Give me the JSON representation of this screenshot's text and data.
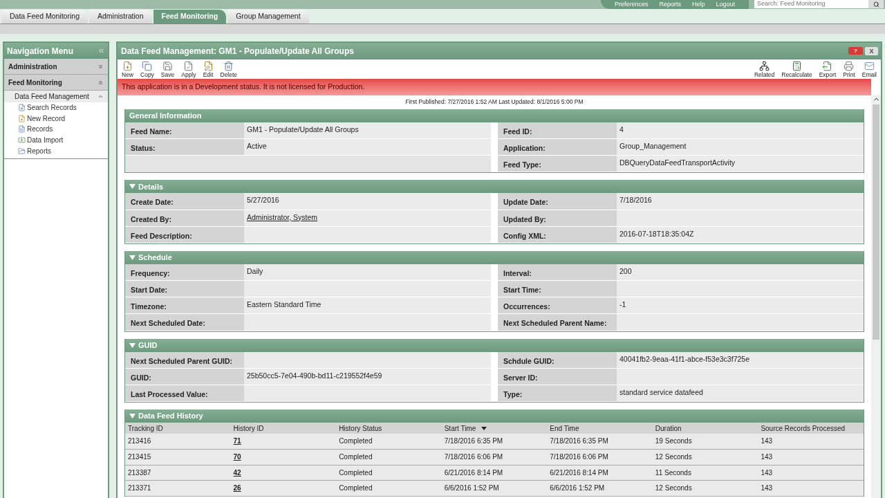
{
  "header": {
    "links": [
      "Preferences",
      "Reports",
      "Help",
      "Logout"
    ],
    "search": {
      "placeholder": "Search: Feed Monitoring"
    }
  },
  "tabs": [
    {
      "label": "Data Feed Monitoring",
      "selected": false
    },
    {
      "label": "Administration",
      "selected": false
    },
    {
      "label": "Feed Monitoring",
      "selected": true
    },
    {
      "label": "Group Management",
      "selected": false
    }
  ],
  "sidebar": {
    "title": "Navigation Menu",
    "groups": [
      {
        "label": "Administration",
        "expanded": false
      },
      {
        "label": "Feed Monitoring",
        "expanded": true,
        "children": [
          {
            "label": "Data Feed Management",
            "expanded": true,
            "children": [
              {
                "label": "Search Records"
              },
              {
                "label": "New Record"
              },
              {
                "label": "Records"
              },
              {
                "label": "Data Import"
              },
              {
                "label": "Reports"
              }
            ]
          }
        ]
      }
    ]
  },
  "window": {
    "title": "Data Feed Management: GM1 - Populate/Update All Groups",
    "help_button": "?",
    "close_button": "X"
  },
  "toolbar": {
    "left": [
      "New",
      "Copy",
      "Save",
      "Apply",
      "Edit",
      "Delete"
    ],
    "right": [
      "Related",
      "Recalculate",
      "Export",
      "Print",
      "Email"
    ]
  },
  "alert": "This application is in a Development status. It is not licensed for Production.",
  "published": "First Published: 7/27/2016 1:52 AM Last Updated: 8/1/2016 5:00 PM",
  "sections": [
    {
      "title": "General Information",
      "rows": [
        {
          "left": {
            "label": "Feed Name:",
            "value": "GM1 - Populate/Update All Groups",
            "kind": "text"
          },
          "right": {
            "label": "Feed ID:",
            "value": "4",
            "kind": "text"
          }
        },
        {
          "left": {
            "label": "Status:",
            "value": "Active",
            "kind": "text"
          },
          "right": {
            "label": "Application:",
            "value": "Group_Management",
            "kind": "text"
          }
        },
        {
          "right": {
            "label": "Feed Type:",
            "value": "DBQueryDataFeedTransportActivity",
            "kind": "text"
          }
        }
      ]
    },
    {
      "title": "Details",
      "expanded": true,
      "rows": [
        {
          "left": {
            "label": "Create Date:",
            "value": "5/27/2016",
            "kind": "text"
          },
          "right": {
            "label": "Update Date:",
            "value": "7/18/2016",
            "kind": "text"
          }
        },
        {
          "left": {
            "label": "Created By:",
            "value": "Administrator, System",
            "kind": "link"
          },
          "right": {
            "label": "Updated By:"
          }
        },
        {
          "left": {
            "label": "Feed Description:"
          },
          "right": {
            "label": "Config XML:",
            "value": "2016-07-18T18:35:04Z",
            "kind": "text"
          }
        }
      ]
    },
    {
      "title": "Schedule",
      "expanded": true,
      "rows": [
        {
          "left": {
            "label": "Frequency:",
            "value": "Daily",
            "kind": "text"
          },
          "right": {
            "label": "Interval:",
            "value": "200",
            "kind": "text"
          }
        },
        {
          "left": {
            "label": "Start Date:"
          },
          "right": {
            "label": "Start Time:"
          }
        },
        {
          "left": {
            "label": "Timezone:",
            "value": "Eastern Standard Time",
            "kind": "text"
          },
          "right": {
            "label": "Occurrences:",
            "value": "-1",
            "kind": "text"
          }
        },
        {
          "left": {
            "label": "Next Scheduled Date:"
          },
          "right": {
            "label": "Next Scheduled Parent Name:"
          }
        }
      ]
    },
    {
      "title": "GUID",
      "expanded": true,
      "rows": [
        {
          "left": {
            "label": "Next Scheduled Parent GUID:"
          },
          "right": {
            "label": "Schdule GUID:",
            "value": "40041fb2-9eaa-41f1-abce-f53e3c3f725e",
            "kind": "text"
          }
        },
        {
          "left": {
            "label": "GUID:",
            "value": "25b50cc5-7e04-490b-bd11-c219552f4e59",
            "kind": "text"
          },
          "right": {
            "label": "Server ID:"
          }
        },
        {
          "left": {
            "label": "Last Processed Value:"
          },
          "right": {
            "label": "Type:",
            "value": "standard service datafeed",
            "kind": "text"
          }
        }
      ]
    }
  ],
  "history": {
    "title": "Data Feed History",
    "expanded": true,
    "columns": [
      {
        "label": "Tracking ID",
        "sorted": false
      },
      {
        "label": "History ID",
        "sorted": false
      },
      {
        "label": "History Status",
        "sorted": false
      },
      {
        "label": "Start Time",
        "sorted": true
      },
      {
        "label": "End Time",
        "sorted": false
      },
      {
        "label": "Duration",
        "sorted": false
      },
      {
        "label": "Source Records Processed",
        "sorted": false
      }
    ],
    "rows": [
      [
        "213416",
        "71",
        "Completed",
        "7/18/2016 6:35 PM",
        "7/18/2016 6:35 PM",
        "19 Seconds",
        "143"
      ],
      [
        "213415",
        "70",
        "Completed",
        "7/18/2016 6:06 PM",
        "7/18/2016 6:06 PM",
        "12 Seconds",
        "143"
      ],
      [
        "213387",
        "42",
        "Completed",
        "6/21/2016 8:14 PM",
        "6/21/2016 8:14 PM",
        "11 Seconds",
        "143"
      ],
      [
        "213371",
        "26",
        "Completed",
        "6/6/2016 1:52 PM",
        "6/6/2016 1:52 PM",
        "12 Seconds",
        "143"
      ]
    ]
  }
}
